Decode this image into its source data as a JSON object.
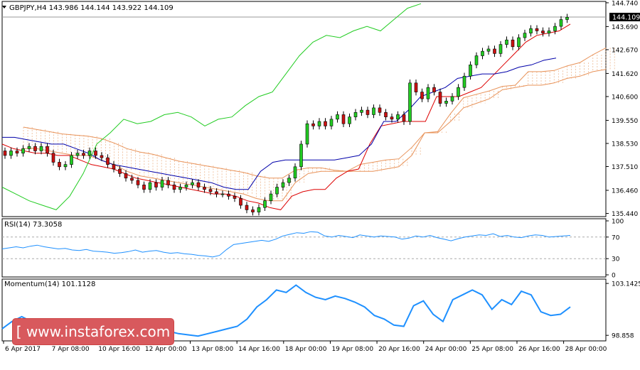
{
  "chart_data": [
    {
      "type": "candlestick",
      "title": "GBPJPY,H4  143.986 144.144 143.922 144.109",
      "last_price": "144.109",
      "ylim": [
        135.3,
        144.8
      ],
      "y_ticks": [
        "144.740",
        "143.690",
        "142.670",
        "141.620",
        "140.600",
        "139.550",
        "138.530",
        "137.510",
        "136.460",
        "135.440"
      ],
      "x_ticks": [
        "6 Apr 2017",
        "7 Apr 08:00",
        "10 Apr 16:00",
        "12 Apr 00:00",
        "13 Apr 08:00",
        "14 Apr 16:00",
        "18 Apr 00:00",
        "19 Apr 08:00",
        "20 Apr 16:00",
        "24 Apr 00:00",
        "25 Apr 08:00",
        "26 Apr 16:00",
        "28 Apr 00:00"
      ],
      "candles_close": [
        138.0,
        138.2,
        138.1,
        138.3,
        138.4,
        138.2,
        138.4,
        138.1,
        137.7,
        137.5,
        137.6,
        138.0,
        138.1,
        138.0,
        138.2,
        138.0,
        137.9,
        137.6,
        137.4,
        137.2,
        137.0,
        136.9,
        136.7,
        136.5,
        136.8,
        136.6,
        136.9,
        136.7,
        136.5,
        136.6,
        136.7,
        136.8,
        136.6,
        136.5,
        136.4,
        136.3,
        136.3,
        136.2,
        136.1,
        135.8,
        135.6,
        135.5,
        135.7,
        136.0,
        136.3,
        136.6,
        136.8,
        137.0,
        137.5,
        138.5,
        139.4,
        139.3,
        139.5,
        139.3,
        139.6,
        139.8,
        139.4,
        139.7,
        139.9,
        140.0,
        139.8,
        140.1,
        139.9,
        139.7,
        139.6,
        139.8,
        139.5,
        141.2,
        140.8,
        140.5,
        141.0,
        140.8,
        140.3,
        140.4,
        140.6,
        141.0,
        141.5,
        142.0,
        142.4,
        142.6,
        142.7,
        142.5,
        142.9,
        143.1,
        142.8,
        143.2,
        143.4,
        143.6,
        143.5,
        143.4,
        143.5,
        143.7,
        144.0,
        144.1
      ],
      "tenkan": [
        138.5,
        138.3,
        138.2,
        138.1,
        138.1,
        138.0,
        138.0,
        137.8,
        137.6,
        137.5,
        137.4,
        137.2,
        137.0,
        136.9,
        136.8,
        136.7,
        136.6,
        136.5,
        136.4,
        136.3,
        136.3,
        136.2,
        136.0,
        135.9,
        135.7,
        135.6,
        136.2,
        136.4,
        136.5,
        136.5,
        137.0,
        137.3,
        137.4,
        138.5,
        139.3,
        139.4,
        139.5,
        139.5,
        139.5,
        140.6,
        140.6,
        140.6,
        140.8,
        141.0,
        141.5,
        142.0,
        142.5,
        143.0,
        143.3,
        143.4,
        143.5,
        143.8
      ],
      "kijun": [
        138.8,
        138.8,
        138.7,
        138.6,
        138.5,
        138.5,
        138.3,
        138.1,
        137.8,
        137.6,
        137.5,
        137.4,
        137.3,
        137.2,
        137.1,
        137.0,
        136.9,
        136.8,
        136.6,
        136.5,
        136.5,
        137.3,
        137.7,
        137.8,
        137.8,
        137.8,
        137.8,
        137.8,
        137.9,
        138.0,
        138.5,
        139.5,
        139.5,
        140.0,
        140.6,
        140.8,
        141.0,
        141.4,
        141.5,
        141.6,
        141.6,
        141.7,
        141.9,
        142.0,
        142.2,
        142.3
      ],
      "chikou": [
        136.6,
        136.3,
        136.0,
        135.8,
        135.6,
        136.2,
        137.2,
        138.5,
        139.0,
        139.6,
        139.4,
        139.5,
        139.8,
        139.9,
        139.7,
        139.3,
        139.6,
        139.7,
        140.2,
        140.6,
        140.8,
        141.6,
        142.4,
        143.0,
        143.3,
        143.2,
        143.5,
        143.7,
        143.5,
        144.0,
        144.5,
        144.7
      ]
    },
    {
      "type": "line",
      "title": "RSI(14) 73.3058",
      "ylim": [
        0,
        100
      ],
      "y_ticks": [
        "100",
        "70",
        "30",
        "0"
      ],
      "levels": [
        70,
        30
      ],
      "values": [
        48,
        50,
        52,
        50,
        53,
        55,
        52,
        50,
        48,
        49,
        46,
        45,
        47,
        44,
        43,
        42,
        40,
        41,
        43,
        46,
        42,
        44,
        45,
        42,
        40,
        41,
        39,
        38,
        36,
        35,
        33,
        36,
        47,
        56,
        58,
        60,
        62,
        64,
        62,
        66,
        72,
        75,
        78,
        77,
        80,
        79,
        72,
        70,
        73,
        71,
        69,
        74,
        72,
        70,
        72,
        71,
        70,
        66,
        68,
        72,
        70,
        73,
        69,
        66,
        63,
        67,
        70,
        72,
        74,
        73,
        76,
        71,
        73,
        70,
        69,
        72,
        74,
        73,
        70,
        71,
        72,
        73
      ]
    },
    {
      "type": "line",
      "title": "Momentum(14) 101.1128",
      "y_ticks": [
        "103.1425",
        "98.858"
      ],
      "ylim": [
        98.4,
        103.5
      ],
      "values": [
        99.4,
        100.0,
        100.4,
        100.0,
        99.5,
        99.0,
        98.7,
        98.9,
        99.3,
        99.1,
        98.9,
        98.8,
        98.7,
        98.8,
        99.0,
        99.1,
        99.3,
        99.2,
        99.0,
        98.9,
        98.8,
        99.0,
        99.2,
        99.4,
        99.6,
        100.2,
        101.2,
        101.8,
        102.6,
        102.4,
        103.0,
        102.4,
        102.0,
        101.8,
        102.1,
        101.9,
        101.6,
        101.2,
        100.5,
        100.2,
        99.7,
        99.6,
        101.3,
        101.7,
        100.6,
        100.0,
        101.8,
        102.2,
        102.6,
        102.2,
        101.0,
        101.8,
        101.4,
        102.5,
        102.2,
        100.8,
        100.5,
        100.6,
        101.2
      ]
    }
  ],
  "watermark": "[ www.instaforex.com ]"
}
